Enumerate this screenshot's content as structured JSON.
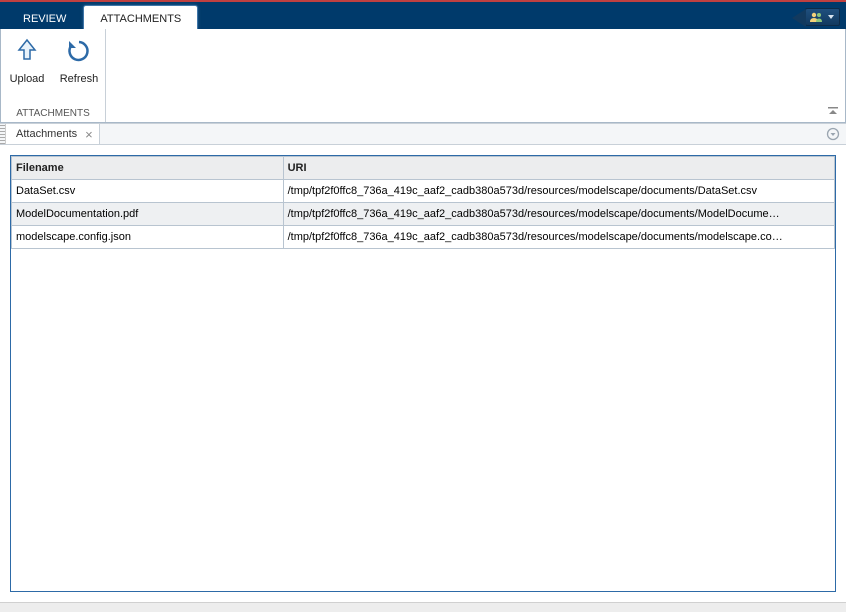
{
  "topbar": {
    "tabs": [
      {
        "label": "REVIEW",
        "active": false
      },
      {
        "label": "ATTACHMENTS",
        "active": true
      }
    ]
  },
  "ribbon": {
    "group_label": "ATTACHMENTS",
    "upload_label": "Upload",
    "refresh_label": "Refresh"
  },
  "subtab": {
    "label": "Attachments",
    "close": "×"
  },
  "table": {
    "headers": {
      "filename": "Filename",
      "uri": "URI"
    },
    "rows": [
      {
        "filename": "DataSet.csv",
        "uri": "/tmp/tpf2f0ffc8_736a_419c_aaf2_cadb380a573d/resources/modelscape/documents/DataSet.csv"
      },
      {
        "filename": "ModelDocumentation.pdf",
        "uri": "/tmp/tpf2f0ffc8_736a_419c_aaf2_cadb380a573d/resources/modelscape/documents/ModelDocume…"
      },
      {
        "filename": "modelscape.config.json",
        "uri": "/tmp/tpf2f0ffc8_736a_419c_aaf2_cadb380a573d/resources/modelscape/documents/modelscape.co…"
      }
    ]
  }
}
